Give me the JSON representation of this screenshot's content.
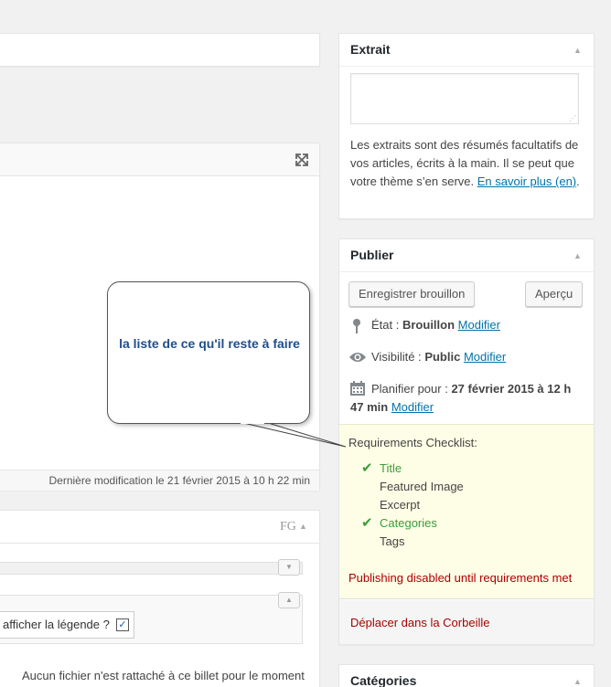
{
  "excerpt": {
    "title": "Extrait",
    "textarea_value": "",
    "help_text": "Les extraits sont des résumés facultatifs de vos articles, écrits à la main. Il se peut que votre thème s’en serve.",
    "learn_more_link": "En savoir plus (en)",
    "help_suffix": "."
  },
  "publish": {
    "title": "Publier",
    "save_draft_label": "Enregistrer brouillon",
    "preview_label": "Aperçu",
    "status_label": "État :",
    "status_value": "Brouillon",
    "status_edit": "Modifier",
    "visibility_label": "Visibilité :",
    "visibility_value": "Public",
    "visibility_edit": "Modifier",
    "schedule_label": "Planifier pour :",
    "schedule_value": "27 février 2015 à 12 h 47 min",
    "schedule_edit": "Modifier",
    "checklist": {
      "title": "Requirements Checklist:",
      "items": [
        {
          "label": "Title",
          "done": true
        },
        {
          "label": "Featured Image",
          "done": false
        },
        {
          "label": "Excerpt",
          "done": false
        },
        {
          "label": "Categories",
          "done": true
        },
        {
          "label": "Tags",
          "done": false
        }
      ],
      "warning": "Publishing disabled until requirements met",
      "done_color": "#3a9d3a",
      "warning_color": "#a00"
    },
    "trash_label": "Déplacer dans la Corbeille"
  },
  "categories": {
    "title": "Catégories"
  },
  "editor": {
    "last_modified": "Dernière modification le 21 février 2015 à 10 h 22 min"
  },
  "gallery_box": {
    "fg_label": "FG",
    "caption_option": "afficher la légende ?",
    "caption_checked": true,
    "no_file_text": "Aucun fichier n'est rattaché à ce billet pour le moment"
  },
  "callout": {
    "text": "la liste de ce qu'il reste à faire",
    "text_color": "#1f4e8c"
  }
}
